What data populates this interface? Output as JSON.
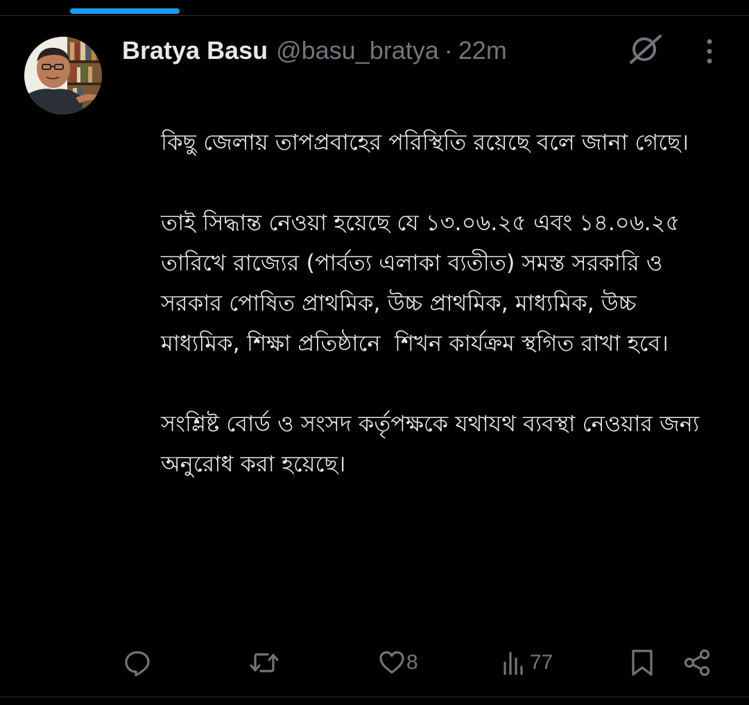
{
  "tweet": {
    "author": {
      "display_name": "Bratya Basu",
      "handle": "@basu_bratya"
    },
    "separator": "·",
    "time": "22m",
    "paragraphs": [
      "কিছু জেলায় তাপপ্রবাহের পরিস্থিতি রয়েছে বলে জানা গেছে।",
      "তাই সিদ্ধান্ত নেওয়া হয়েছে যে ১৩.০৬.২৫ এবং ১৪.০৬.২৫ তারিখে রাজ্যের (পার্বত্য এলাকা ব্যতীত) সমস্ত সরকারি ও সরকার পোষিত প্রাথমিক, উচ্চ প্রাথমিক, মাধ্যমিক, উচ্চ মাধ্যমিক, শিক্ষা প্রতিষ্ঠানে  শিখন কার্যক্রম স্থগিত রাখা হবে।",
      "সংশ্লিষ্ট বোর্ড ও সংসদ কর্তৃপক্ষকে যথাযথ ব্যবস্থা নেওয়ার জন্য অনুরোধ করা হয়েছে।"
    ],
    "actions": {
      "reply_icon": "reply-icon",
      "retweet_icon": "retweet-icon",
      "like_icon": "heart-icon",
      "like_count": "8",
      "views_icon": "views-icon",
      "view_count": "77",
      "bookmark_icon": "bookmark-icon",
      "share_icon": "share-icon"
    }
  },
  "header_icons": {
    "grok": "grok-icon",
    "more": "more-icon"
  },
  "colors": {
    "background": "#000000",
    "text_primary": "#e7e9ea",
    "text_secondary": "#71767b",
    "accent": "#1d9bf0",
    "divider": "#2f3336"
  }
}
